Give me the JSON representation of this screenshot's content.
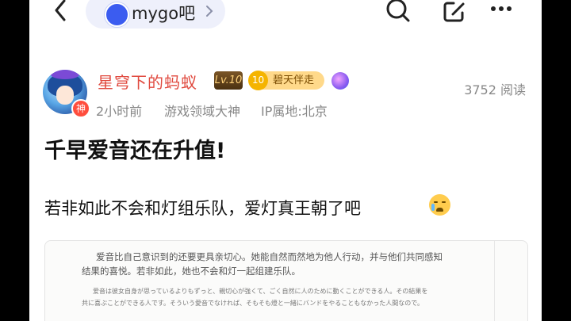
{
  "nav": {
    "forum_name": "mygo吧"
  },
  "post": {
    "author": {
      "name": "星穹下的蚂蚁",
      "level": "Lv.10",
      "fan_badge_num": "10",
      "fan_badge_text": "碧天伴走",
      "god_badge": "神",
      "time": "2小时前",
      "role": "游戏领域大神",
      "ip": "IP属地:北京"
    },
    "views": "3752 阅读",
    "title": "千早爱音还在升值!",
    "body": "若非如此不会和灯组乐队，爱灯真王朝了吧",
    "image_text": {
      "line1": "爱音比自己意识到的还要更具亲切心。她能自然而然地为他人行动，并与他们共同感知",
      "line2": "结果的喜悦。若非如此，她也不会和灯一起组建乐队。",
      "line3": "爱音は彼女自身が思っているよりもずっと、親切心が強くて、ごく自然に人のために動くことができる人。その結果を",
      "line4": "共に喜ぶことができる人です。そういう愛音でなければ、そもそも燈と一緒にバンドをやることもなかった人間なので。"
    }
  },
  "colors": {
    "username": "#e04a3f",
    "meta": "#888888",
    "forum_pill": "#eef0fb"
  }
}
